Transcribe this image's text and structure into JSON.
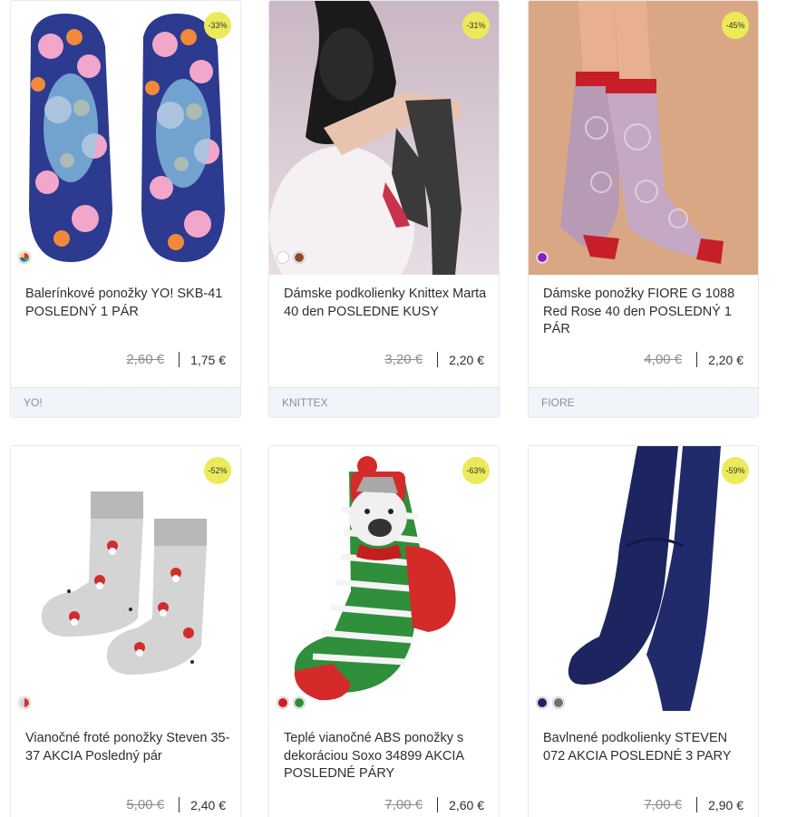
{
  "products": [
    {
      "title": "Balerínkové ponožky YO! SKB-41 POSLEDNÝ 1 PÁR",
      "discount": "-33%",
      "old_price": "2,60 €",
      "price": "1,75 €",
      "brand": "YO!",
      "swatches": [
        "#e8a0c0"
      ],
      "image": "floral-ballerina-socks"
    },
    {
      "title": "Dámske podkolienky Knittex Marta 40 den POSLEDNE KUSY",
      "discount": "-31%",
      "old_price": "3,20 €",
      "price": "2,20 €",
      "brand": "KNITTEX",
      "swatches": [
        "#ffffff",
        "#8b4a2b"
      ],
      "image": "woman-black-knee-highs"
    },
    {
      "title": "Dámske ponožky FIORE G 1088 Red Rose 40 den POSLEDNÝ 1 PÁR",
      "discount": "-45%",
      "old_price": "4,00 €",
      "price": "2,20 €",
      "brand": "FIORE",
      "swatches": [
        "#8a1fc0"
      ],
      "image": "rose-pattern-socks"
    },
    {
      "title": "Vianočné froté ponožky Steven 35-37 AKCIA Posledný pár",
      "discount": "-52%",
      "old_price": "5,00 €",
      "price": "2,40 €",
      "brand": "",
      "swatches": [
        "#d83030"
      ],
      "image": "christmas-santa-socks"
    },
    {
      "title": "Teplé vianočné ABS ponožky s dekoráciou Soxo 34899 AKCIA POSLEDNÉ PÁRY",
      "discount": "-63%",
      "old_price": "7,00 €",
      "price": "2,60 €",
      "brand": "",
      "swatches": [
        "#c82020",
        "#2e8b3a"
      ],
      "image": "striped-bear-socks"
    },
    {
      "title": "Bavlnené podkolienky STEVEN 072 AKCIA POSLEDNÉ 3 PARY",
      "discount": "-59%",
      "old_price": "7,00 €",
      "price": "2,90 €",
      "brand": "",
      "swatches": [
        "#1c2560",
        "#707070"
      ],
      "image": "navy-knee-socks"
    }
  ],
  "colors": {
    "badge": "#ecea5a",
    "brand_bar": "#f1f4f8"
  }
}
